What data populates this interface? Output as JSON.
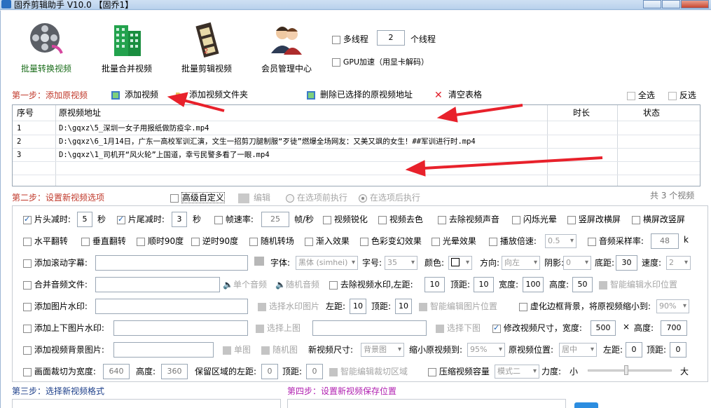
{
  "window": {
    "title": "固乔剪辑助手 V10.0  【固乔1】"
  },
  "toolbar": {
    "items": [
      {
        "label": "批量转换视频",
        "icon": "film-reel-icon"
      },
      {
        "label": "批量合并视频",
        "icon": "building-icon"
      },
      {
        "label": "批量剪辑视频",
        "icon": "film-strip-icon"
      },
      {
        "label": "会员管理中心",
        "icon": "users-icon"
      }
    ],
    "multithread_label": "多线程",
    "thread_count": "2",
    "thread_unit": "个线程",
    "gpu_label": "GPU加速（用显卡解码）"
  },
  "step1": {
    "title": "第一步：添加原视频",
    "add_video": "添加视频",
    "add_folder": "添加视频文件夹",
    "delete_selected": "删除已选择的原视频地址",
    "clear_table": "清空表格",
    "select_all": "全选",
    "invert": "反选"
  },
  "table": {
    "headers": [
      "序号",
      "原视频地址",
      "时长",
      "状态"
    ],
    "rows": [
      {
        "no": "1",
        "path": "D:\\gqxz\\5_深圳一女子用报纸做防疫伞.mp4"
      },
      {
        "no": "2",
        "path": "D:\\gqxz\\6_1月14日，广东一高校军训汇演，文生一招剪刀腿制服“歹徒”燃爆全场网友：又美又飒的女生！##军训进行时.mp4"
      },
      {
        "no": "3",
        "path": "D:\\gqxz\\1_司机开“风火轮”上国道，幸亏民警多看了一眼.mp4"
      }
    ]
  },
  "step2": {
    "title": "第二步：设置新视频选项",
    "advanced": "高级自定义",
    "edit": "编辑",
    "before": "在选项前执行",
    "after": "在选项后执行",
    "count": "共 3 个视频"
  },
  "opts": {
    "r1": {
      "head_cut": "片头减时:",
      "head_val": "5",
      "sec": "秒",
      "tail_cut": "片尾减时:",
      "tail_val": "3",
      "fps": "帧速率:",
      "fps_val": "25",
      "fps_unit": "帧/秒",
      "sharpen": "视频锐化",
      "decolor": "视频去色",
      "mute": "去除视频声音",
      "flash": "闪烁光晕",
      "v2h": "竖屏改横屏",
      "h2v": "横屏改竖屏"
    },
    "r2": {
      "hflip": "水平翻转",
      "vflip": "垂直翻转",
      "cw": "顺时90度",
      "ccw": "逆时90度",
      "trans": "随机转场",
      "fadein": "渐入效果",
      "color": "色彩变幻效果",
      "halo": "光晕效果",
      "speed": "播放倍速:",
      "speed_val": "0.5",
      "rate": "音频采样率:",
      "rate_val": "48",
      "rate_unit": "k"
    },
    "r3": {
      "scroll": "添加滚动字幕:",
      "font": "字体:",
      "font_val": "黑体 (simhei)",
      "size": "字号:",
      "size_val": "35",
      "color": "颜色:",
      "dir": "方向:",
      "dir_val": "向左",
      "shadow": "阴影:",
      "shadow_val": "0",
      "bottom": "底距:",
      "bottom_val": "30",
      "spd": "速度:",
      "spd_val": "2"
    },
    "r4": {
      "merge_audio": "合并音频文件:",
      "single_audio": "单个音频",
      "random_audio": "随机音频",
      "rm_wm": "去除视频水印,",
      "left": "左距:",
      "left_val": "10",
      "top": "顶距:",
      "top_val": "10",
      "width": "宽度:",
      "width_val": "100",
      "height": "高度:",
      "height_val": "50",
      "smart_wm": "智能编辑水印位置"
    },
    "r5": {
      "img_wm": "添加图片水印:",
      "pick_img": "选择水印图片",
      "left": "左距:",
      "left_val": "10",
      "top": "顶距:",
      "top_val": "10",
      "smart_img": "智能编辑图片位置",
      "blur_bg": "虚化边框背景，将原视频缩小到:",
      "blur_val": "90%"
    },
    "r6": {
      "ud_wm": "添加上下图片水印:",
      "pick_up": "选择上图",
      "pick_down": "选择下图",
      "resize": "修改视频尺寸，宽度:",
      "w_val": "500",
      "x": "×",
      "height": "高度:",
      "h_val": "700"
    },
    "r7": {
      "bg_img": "添加视频背景图片:",
      "single": "单图",
      "random": "随机图",
      "new_size": "新视频尺寸:",
      "new_size_val": "背景图",
      "shrink": "缩小原视频到:",
      "shrink_val": "95%",
      "pos": "原视频位置:",
      "pos_val": "居中",
      "left": "左距:",
      "left_val": "0",
      "top": "顶距:",
      "top_val": "0"
    },
    "r8": {
      "crop": "画面裁切为宽度:",
      "crop_w": "640",
      "height": "高度:",
      "crop_h": "360",
      "keep_left": "保留区域的左距:",
      "keep_left_val": "0",
      "top": "顶距:",
      "top_val": "0",
      "smart_crop": "智能编辑裁切区域",
      "compress": "压缩视频容量",
      "mode_val": "模式二",
      "force": "力度:",
      "small": "小",
      "big": "大"
    }
  },
  "step3": {
    "title": "第三步：选择新视频格式"
  },
  "step4": {
    "title": "第四步：设置新视频保存位置"
  }
}
